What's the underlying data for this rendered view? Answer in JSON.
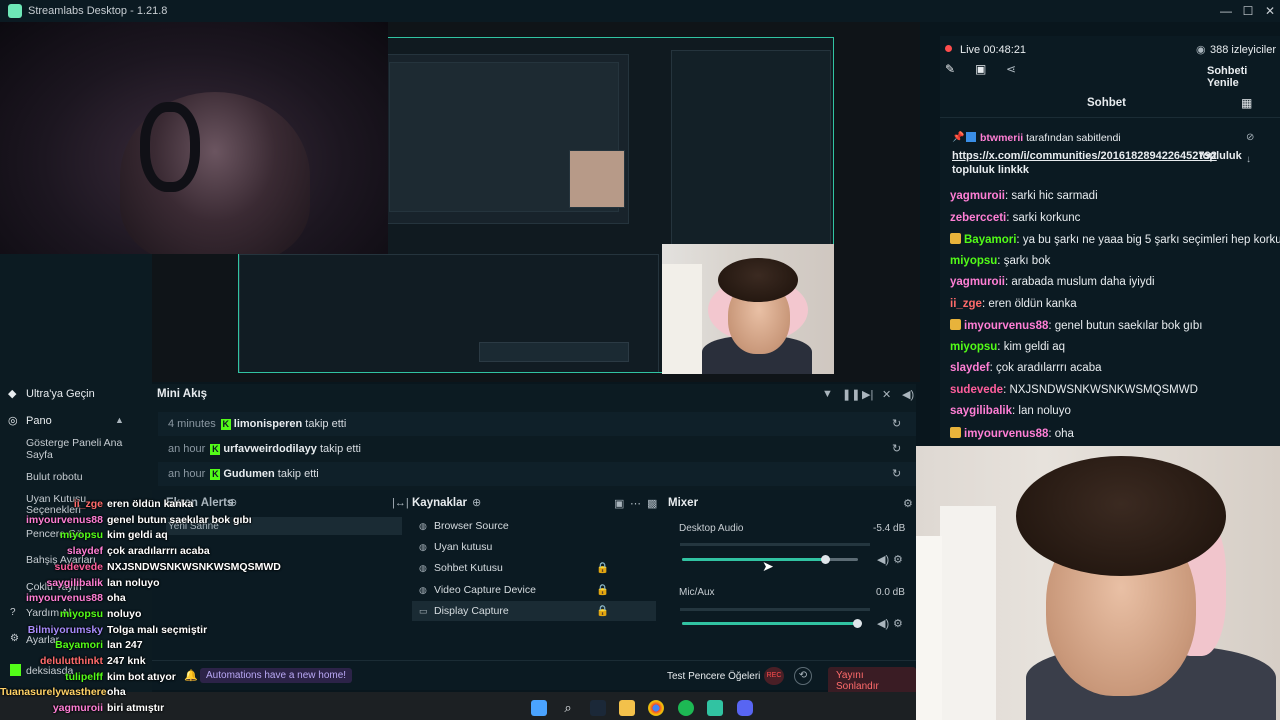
{
  "app": {
    "title": "Streamlabs Desktop - 1.21.8"
  },
  "window_controls": {
    "minimize": "—",
    "maximize": "☐",
    "close": "✕"
  },
  "live": {
    "status": "Live 00:48:21",
    "viewers": "388 izleyiciler",
    "refresh_label": "Sohbeti Yenile"
  },
  "chat": {
    "title": "Sohbet",
    "pinned": {
      "by": "btwmerii tarafından sabitlendi",
      "link": "https://x.com/i/communities/2016182894226452792",
      "text": "topluluk linkkk"
    },
    "messages": [
      {
        "user": "yagmuroii",
        "text": "sarki hic sarmadi",
        "color": "#ff7fd5",
        "badge": ""
      },
      {
        "user": "zebercceti",
        "text": "sarki korkunc",
        "color": "#ff7fd5",
        "badge": ""
      },
      {
        "user": "Bayamori",
        "text": "ya bu şarkı ne yaaa big 5 şarkı seçimleri hep korkunç",
        "color": "#53fc18",
        "badge": "#e8b33b"
      },
      {
        "user": "miyopsu",
        "text": "şarkı bok",
        "color": "#53fc18",
        "badge": ""
      },
      {
        "user": "yagmuroii",
        "text": "arabada muslum daha iyiydi",
        "color": "#ff7fd5",
        "badge": ""
      },
      {
        "user": "ii_zge",
        "text": "eren öldün kanka",
        "color": "#ff6b6b",
        "badge": ""
      },
      {
        "user": "imyourvenus88",
        "text": "genel butun saekılar bok gıbı",
        "color": "#ff7fd5",
        "badge": "#e8b33b"
      },
      {
        "user": "miyopsu",
        "text": "kim geldi aq",
        "color": "#53fc18",
        "badge": ""
      },
      {
        "user": "slaydef",
        "text": "çok aradılarrrı acaba",
        "color": "#ff7fd5",
        "badge": ""
      },
      {
        "user": "sudevede",
        "text": "NXJSNDWSNKWSNKWSMQSMWD",
        "color": "#ff5e9c",
        "badge": ""
      },
      {
        "user": "saygilibalik",
        "text": "lan noluyo",
        "color": "#ff7fd5",
        "badge": ""
      },
      {
        "user": "imyourvenus88",
        "text": "oha",
        "color": "#ff7fd5",
        "badge": "#e8b33b"
      }
    ]
  },
  "sidebar": {
    "items": [
      {
        "label": "Ultra'ya Geçin",
        "icon": "diamond-icon"
      },
      {
        "label": "Pano",
        "icon": "dashboard-icon"
      },
      {
        "label": "Gösterge Paneli Ana Sayfa"
      },
      {
        "label": "Bulut robotu"
      },
      {
        "label": "Uyan Kutusu Seçenekleri"
      },
      {
        "label": "Pencere Gö..."
      },
      {
        "label": "Bahşiş Ayarları"
      },
      {
        "label": "Çoklu Yayın"
      },
      {
        "label": "Yardım Al"
      },
      {
        "label": "Ayarlar"
      },
      {
        "label": "deksiasda"
      }
    ]
  },
  "activity": {
    "title": "Mini Akış",
    "rows": [
      {
        "time": "4 minutes",
        "name": "limonisperen",
        "action": "takip etti"
      },
      {
        "time": "an hour",
        "name": "urfavweirdodilayy",
        "action": "takip etti"
      },
      {
        "time": "an hour",
        "name": "Gudumen",
        "action": "takip etti"
      }
    ]
  },
  "scenes": {
    "title": "Ekran Alerts",
    "item": "Yeni Sahne"
  },
  "sources": {
    "title": "Kaynaklar",
    "items": [
      "Browser Source",
      "Uyan kutusu",
      "Sohbet Kutusu",
      "Video Capture Device",
      "Display Capture"
    ]
  },
  "mixer": {
    "title": "Mixer",
    "channels": [
      {
        "name": "Desktop Audio",
        "db": "-5.4 dB",
        "level": 0.82
      },
      {
        "name": "Mic/Aux",
        "db": "0.0 dB",
        "level": 1.0
      }
    ]
  },
  "footer": {
    "notice": "Automations have a new home!",
    "test_label": "Test Pencere Öğeleri",
    "rec": "REC",
    "end_stream": "Yayını Sonlandır"
  },
  "overlay_chat": [
    {
      "user": "ii_zge",
      "text": "eren öldün kanka",
      "color": "#ff6b6b"
    },
    {
      "user": "imyourvenus88",
      "text": "genel butun saekılar bok gıbı",
      "color": "#ff7fd5"
    },
    {
      "user": "miyopsu",
      "text": "kim geldi aq",
      "color": "#53fc18"
    },
    {
      "user": "slaydef",
      "text": "çok aradılarrrı acaba",
      "color": "#ff7fd5"
    },
    {
      "user": "sudevede",
      "text": "NXJSNDWSNKWSNKWSMQSMWD",
      "color": "#ff5e9c"
    },
    {
      "user": "saygilibalik",
      "text": "lan noluyo",
      "color": "#ff7fd5"
    },
    {
      "user": "imyourvenus88",
      "text": "oha",
      "color": "#ff7fd5"
    },
    {
      "user": "miyopsu",
      "text": "noluyo",
      "color": "#53fc18"
    },
    {
      "user": "Bilmiyorumsky",
      "text": "Tolga malı seçmiştir",
      "color": "#a78bfa"
    },
    {
      "user": "Bayamori",
      "text": "lan 247",
      "color": "#53fc18"
    },
    {
      "user": "delulutthinkt",
      "text": "247 knk",
      "color": "#ff6b6b"
    },
    {
      "user": "tulipelff",
      "text": "kim bot atıyor",
      "color": "#53fc18"
    },
    {
      "user": "Tuanasurelywasthere",
      "text": "oha",
      "color": "#ffd166"
    },
    {
      "user": "yagmuroii",
      "text": "biri atmıştır",
      "color": "#ff7fd5"
    }
  ],
  "icons": {
    "record": "red-record-icon",
    "eye": "eye-icon",
    "pencil": "pencil-icon",
    "share": "share-icon"
  }
}
